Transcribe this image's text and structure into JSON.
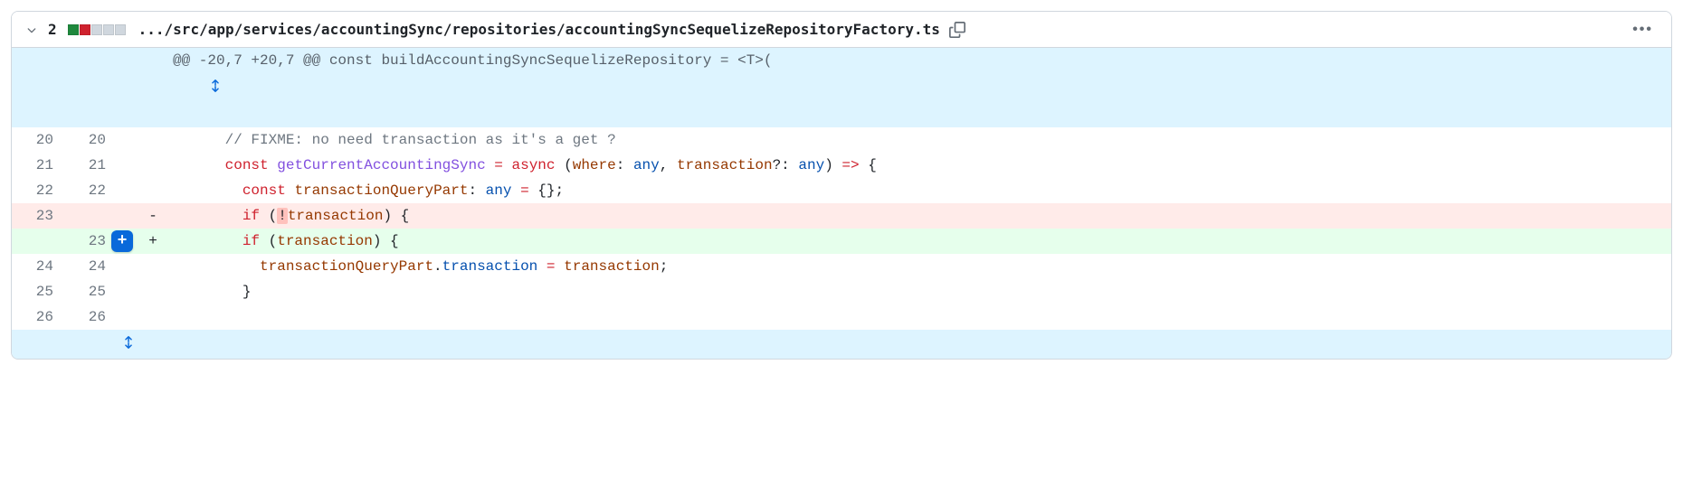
{
  "header": {
    "change_count": "2",
    "file_path": ".../src/app/services/accountingSync/repositories/accountingSyncSequelizeRepositoryFactory.ts",
    "stat_squares": [
      "add",
      "del",
      "neutral",
      "neutral",
      "neutral"
    ],
    "kebab": "•••"
  },
  "hunk": {
    "text": "@@ -20,7 +20,7 @@ const buildAccountingSyncSequelizeRepository = <T>("
  },
  "lines": [
    {
      "old": "20",
      "new": "20",
      "type": "ctx",
      "sign": " ",
      "segments": [
        {
          "t": "      ",
          "c": ""
        },
        {
          "t": "// FIXME: no need transaction as it's a get ?",
          "c": "tok-comment"
        }
      ]
    },
    {
      "old": "21",
      "new": "21",
      "type": "ctx",
      "sign": " ",
      "segments": [
        {
          "t": "      ",
          "c": ""
        },
        {
          "t": "const",
          "c": "tok-kw"
        },
        {
          "t": " ",
          "c": ""
        },
        {
          "t": "getCurrentAccountingSync",
          "c": "tok-fn"
        },
        {
          "t": " ",
          "c": ""
        },
        {
          "t": "=",
          "c": "tok-kw"
        },
        {
          "t": " ",
          "c": ""
        },
        {
          "t": "async",
          "c": "tok-kw"
        },
        {
          "t": " (",
          "c": ""
        },
        {
          "t": "where",
          "c": "tok-var"
        },
        {
          "t": ": ",
          "c": ""
        },
        {
          "t": "any",
          "c": "tok-type"
        },
        {
          "t": ", ",
          "c": ""
        },
        {
          "t": "transaction",
          "c": "tok-var"
        },
        {
          "t": "?: ",
          "c": ""
        },
        {
          "t": "any",
          "c": "tok-type"
        },
        {
          "t": ") ",
          "c": ""
        },
        {
          "t": "=>",
          "c": "tok-kw"
        },
        {
          "t": " {",
          "c": ""
        }
      ]
    },
    {
      "old": "22",
      "new": "22",
      "type": "ctx",
      "sign": " ",
      "segments": [
        {
          "t": "        ",
          "c": ""
        },
        {
          "t": "const",
          "c": "tok-kw"
        },
        {
          "t": " ",
          "c": ""
        },
        {
          "t": "transactionQueryPart",
          "c": "tok-var"
        },
        {
          "t": ": ",
          "c": ""
        },
        {
          "t": "any",
          "c": "tok-type"
        },
        {
          "t": " ",
          "c": ""
        },
        {
          "t": "=",
          "c": "tok-kw"
        },
        {
          "t": " {};",
          "c": ""
        }
      ]
    },
    {
      "old": "23",
      "new": "",
      "type": "del",
      "sign": "-",
      "segments": [
        {
          "t": "        ",
          "c": ""
        },
        {
          "t": "if",
          "c": "tok-kw"
        },
        {
          "t": " (",
          "c": ""
        },
        {
          "t": "!",
          "c": "hl-del"
        },
        {
          "t": "transaction",
          "c": "tok-var"
        },
        {
          "t": ") {",
          "c": ""
        }
      ]
    },
    {
      "old": "",
      "new": "23",
      "type": "add",
      "sign": "+",
      "plus_button": true,
      "segments": [
        {
          "t": "        ",
          "c": ""
        },
        {
          "t": "if",
          "c": "tok-kw"
        },
        {
          "t": " (",
          "c": ""
        },
        {
          "t": "transaction",
          "c": "tok-var"
        },
        {
          "t": ") {",
          "c": ""
        }
      ]
    },
    {
      "old": "24",
      "new": "24",
      "type": "ctx",
      "sign": " ",
      "segments": [
        {
          "t": "          ",
          "c": ""
        },
        {
          "t": "transactionQueryPart",
          "c": "tok-var"
        },
        {
          "t": ".",
          "c": ""
        },
        {
          "t": "transaction",
          "c": "tok-type"
        },
        {
          "t": " ",
          "c": ""
        },
        {
          "t": "=",
          "c": "tok-kw"
        },
        {
          "t": " ",
          "c": ""
        },
        {
          "t": "transaction",
          "c": "tok-var"
        },
        {
          "t": ";",
          "c": ""
        }
      ]
    },
    {
      "old": "25",
      "new": "25",
      "type": "ctx",
      "sign": " ",
      "segments": [
        {
          "t": "        }",
          "c": ""
        }
      ]
    },
    {
      "old": "26",
      "new": "26",
      "type": "ctx",
      "sign": " ",
      "segments": []
    }
  ]
}
